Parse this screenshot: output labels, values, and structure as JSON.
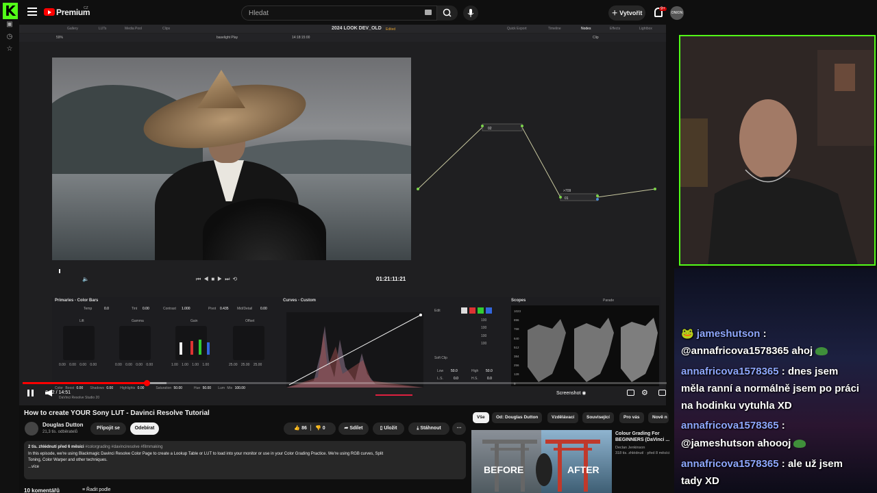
{
  "kick": {
    "logo_letter": "K",
    "accent": "#53fc18"
  },
  "youtube": {
    "brand": "Premium",
    "brand_suffix": "CZ",
    "search_placeholder": "Hledat",
    "create_label": "Vytvořit",
    "notif_count": "9+",
    "avatar_text": "ONION"
  },
  "resolve": {
    "tabs": [
      "Gallery",
      "LUTs",
      "Media Pool",
      "Clips"
    ],
    "right_tabs": [
      "Quick Export",
      "Timeline",
      "Nodes",
      "Effects",
      "Lightbox"
    ],
    "project_title": "2024 LOOK DEV_OLD",
    "edited": "Edited",
    "zoom": "59%",
    "clip_name": "baselight Play",
    "clip_tc": "14:18:15:00",
    "clip_menu": "Clip",
    "viewer_timecode": "01:21:11:21",
    "node_labels": [
      "02",
      "01",
      ">709"
    ],
    "primaries_title": "Primaries - Color Bars",
    "temp_label": "Temp",
    "temp_val": "0.0",
    "tint_label": "Tint",
    "tint_val": "0.00",
    "contrast_label": "Contrast",
    "contrast_val": "1.000",
    "pivot_label": "Pivot",
    "pivot_val": "0.435",
    "middetail_label": "Mid/Detail",
    "middetail_val": "0.00",
    "wheels": [
      {
        "name": "Lift",
        "vals": [
          "0.00",
          "0.00",
          "0.00",
          "0.00"
        ]
      },
      {
        "name": "Gamma",
        "vals": [
          "0.00",
          "0.00",
          "0.00",
          "0.00"
        ]
      },
      {
        "name": "Gain",
        "vals": [
          "1.00",
          "1.00",
          "1.00",
          "1.00"
        ]
      },
      {
        "name": "Offset",
        "vals": [
          "25.00",
          "25.00",
          "25.00"
        ]
      }
    ],
    "bottom_params": [
      {
        "label": "Color Boost",
        "val": "0.00"
      },
      {
        "label": "Shadows",
        "val": "0.00"
      },
      {
        "label": "Highlights",
        "val": "0.00"
      },
      {
        "label": "Saturation",
        "val": "50.00"
      },
      {
        "label": "Hue",
        "val": "50.00"
      },
      {
        "label": "Lum Mix",
        "val": "100.00"
      }
    ],
    "curves_title": "Curves - Custom",
    "edit_label": "Edit",
    "edit_vals": [
      "100",
      "100",
      "100",
      "100"
    ],
    "softclip_label": "Soft Clip",
    "low_label": "Low",
    "low_val": "50.0",
    "high_label": "High",
    "high_val": "50.0",
    "ls_label": "L.S.",
    "ls_val": "0.0",
    "hs_label": "H.S.",
    "hs_val": "0.0",
    "scopes_title": "Scopes",
    "scopes_mode": "Parade",
    "scope_ticks": [
      "1023",
      "896",
      "768",
      "640",
      "512",
      "384",
      "256",
      "128",
      "0"
    ],
    "studio_label": "DaVinci Resolve Studio 20"
  },
  "player": {
    "time": "2:52 / 14:51",
    "progress": 0.193,
    "screenshot_label": "Screenshot"
  },
  "video": {
    "title": "How to create YOUR Sony LUT - Davinci Resolve Tutorial",
    "channel": "Douglas Dutton",
    "subs": "21,3 tis. odběratelů",
    "join_label": "Připojit se",
    "subscribe_label": "Odebírat",
    "likes": "86",
    "dislikes": "0",
    "share_label": "Sdílet",
    "save_label": "Uložit",
    "download_label": "Stáhnout",
    "desc_meta": "2 tis. zhlédnutí  před 6 měsíci",
    "desc_tags": "#colorgrading #davinciresolve #filmmaking",
    "desc_line1": "In this episode, we're using Blackmagic Davinci Resolve Color Page to create a Lookup Table or LUT to load into your monitor or use in your Color Grading Practice. We're using RGB curves, Split",
    "desc_line2": "Toning, Color Warper and other techniques.",
    "desc_more": "...více",
    "comments_label": "10 komentářů",
    "sort_label": "Řadit podle"
  },
  "chips": [
    "Vše",
    "Od: Douglas Dutton",
    "Vzdělávací",
    "Související",
    "Pro vás",
    "Nově n"
  ],
  "rec": {
    "title": "Colour Grading For BEGINNERS (DaVinci ...",
    "channel": "Declan Jenkinson",
    "meta": "318 tis. zhlédnutí · před 8 měsíci",
    "before": "BEFORE",
    "after": "AFTER"
  },
  "chat": [
    {
      "user": "jameshutson",
      "text": ":"
    },
    {
      "user": "",
      "text": "@annafricova1578365 ahoj"
    },
    {
      "user": "annafricova1578365",
      "text": ": dnes jsem"
    },
    {
      "user": "",
      "text": "měla ranní a normálně jsem po práci"
    },
    {
      "user": "",
      "text": "na hodinku vytuhla XD"
    },
    {
      "user": "annafricova1578365",
      "text": ":"
    },
    {
      "user": "",
      "text": "@jameshutson ahoooj"
    },
    {
      "user": "annafricova1578365",
      "text": ": ale už jsem"
    },
    {
      "user": "",
      "text": "tady XD"
    }
  ]
}
